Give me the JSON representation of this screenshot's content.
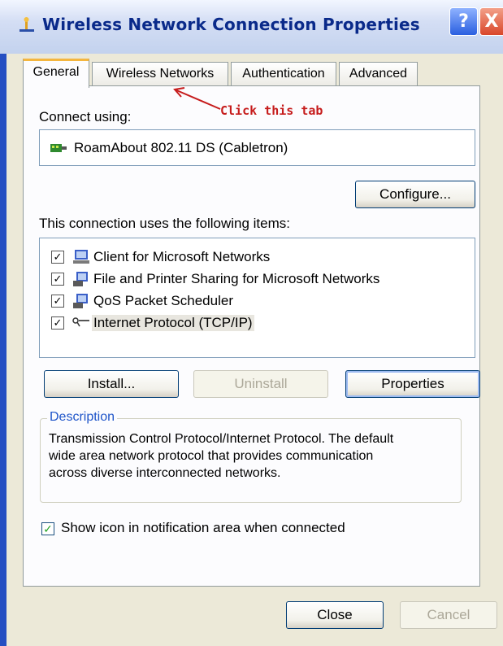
{
  "window": {
    "title": "Wireless Network Connection Properties",
    "help_label": "?",
    "close_label": "X"
  },
  "tabs": [
    {
      "label": "General",
      "active": true
    },
    {
      "label": "Wireless Networks",
      "active": false
    },
    {
      "label": "Authentication",
      "active": false
    },
    {
      "label": "Advanced",
      "active": false
    }
  ],
  "annotation": {
    "text": "Click this tab",
    "color": "#c61c1c"
  },
  "connect_using": {
    "label": "Connect using:",
    "adapter": "RoamAbout 802.11 DS (Cabletron)",
    "adapter_icon": "network-card-icon",
    "configure_label": "Configure..."
  },
  "items_section": {
    "label": "This connection uses the following items:",
    "items": [
      {
        "label": "Client for Microsoft Networks",
        "checked": true,
        "icon": "client-network-icon"
      },
      {
        "label": "File and Printer Sharing for Microsoft Networks",
        "checked": true,
        "icon": "file-printer-sharing-icon"
      },
      {
        "label": "QoS Packet Scheduler",
        "checked": true,
        "icon": "qos-scheduler-icon"
      },
      {
        "label": "Internet Protocol (TCP/IP)",
        "checked": true,
        "icon": "protocol-icon",
        "selected": true
      }
    ]
  },
  "actions": {
    "install_label": "Install...",
    "uninstall_label": "Uninstall",
    "properties_label": "Properties"
  },
  "description": {
    "title": "Description",
    "lines": [
      "Transmission Control Protocol/Internet Protocol. The default",
      "wide area network protocol that provides communication",
      "across diverse interconnected networks."
    ]
  },
  "notify_option": {
    "label": "Show icon in notification area when connected",
    "checked": true
  },
  "footer": {
    "close_label": "Close",
    "cancel_label": "Cancel"
  },
  "colors": {
    "title_text": "#0a2a8a",
    "dialog_bg": "#ece9d8",
    "active_tab_accent": "#f4b63f",
    "group_title": "#1f55c9"
  }
}
